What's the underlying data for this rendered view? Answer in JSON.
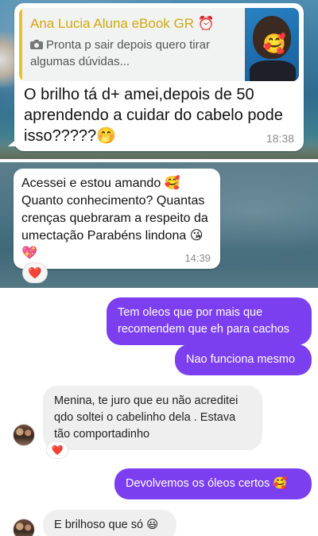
{
  "whatsapp_1": {
    "quoted_sender": "Ana Lucia Aluna eBook GR ⏰",
    "quoted_icon": "camera-icon",
    "quoted_text": "Pronta p sair depois quero tirar algumas dúvidas...",
    "quoted_thumb_emoji": "🥰",
    "message": "O brilho tá d+ amei,depois de 50 aprendendo a cuidar do cabelo pode isso?????🤭",
    "time": "18:38"
  },
  "whatsapp_2": {
    "message": "Acessei e estou amando 🥰 Quanto conhecimento? Quantas crenças quebraram a respeito da umectação Parabéns lindona 😘💖",
    "time": "14:39",
    "reaction": "❤️"
  },
  "dm": {
    "sent_1": "Tem oleos que por mais que recomendem que eh para cachos",
    "sent_2": "Nao funciona mesmo",
    "recv_1": "Menina, te juro que eu não acreditei qdo soltei o cabelinho dela . Estava tão comportadinho",
    "recv_1_reaction": "❤️",
    "sent_3": "Devolvemos os óleos certos 🥰",
    "recv_2": "E brilhoso que só 😃",
    "colors": {
      "sent_bubble": "#7b3ff0",
      "recv_bubble": "#efefef",
      "quote_bar": "#e6c229"
    }
  }
}
